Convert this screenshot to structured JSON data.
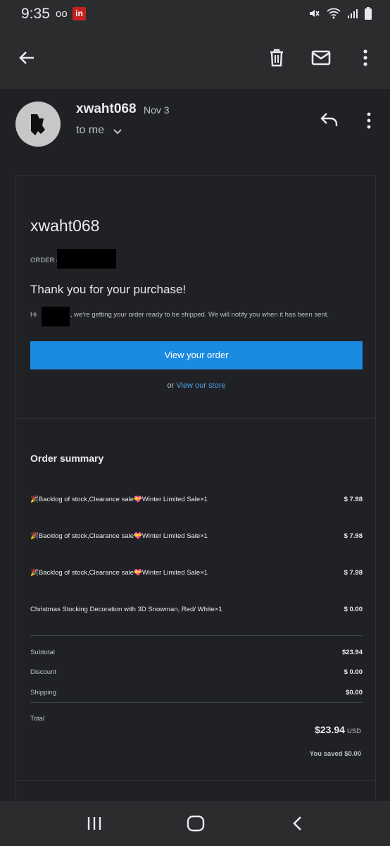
{
  "status": {
    "time": "9:35",
    "voicemail": "oo",
    "notif_badge": "in"
  },
  "appbar": {
    "back_icon": "arrow-left-icon",
    "delete_icon": "trash-icon",
    "mark_unread_icon": "envelope-icon",
    "more_icon": "more-vert-icon"
  },
  "email": {
    "sender": "xwaht068",
    "date": "Nov 3",
    "recipient": "to me",
    "reply_icon": "reply-icon"
  },
  "order": {
    "store_title": "xwaht068",
    "order_label": "ORDER #",
    "thanks": "Thank you for your purchase!",
    "hi_prefix": "Hi",
    "hi_message": "n, we're getting your order ready to be shipped. We will notify you when it has been sent.",
    "view_order": "View your order",
    "or_text": "or",
    "view_store": "View our store"
  },
  "summary": {
    "title": "Order summary",
    "items": [
      {
        "name": "🎉Backlog of stock,Clearance sale💝Winter Limited Sale×1",
        "price": "$ 7.98"
      },
      {
        "name": "🎉Backlog of stock,Clearance sale💝Winter Limited Sale×1",
        "price": "$ 7.98"
      },
      {
        "name": "🎉Backlog of stock,Clearance sale💝Winter Limited Sale×1",
        "price": "$ 7.98"
      },
      {
        "name": "Christmas Stocking Decoration with 3D Snowman, Red/ White×1",
        "price": "$ 0.00"
      }
    ],
    "subtotal_label": "Subtotal",
    "subtotal": "$23.94",
    "discount_label": "Discount",
    "discount": "$ 0.00",
    "shipping_label": "Shipping",
    "shipping": "$0.00",
    "total_label": "Total",
    "total": "$23.94",
    "currency": "USD",
    "saved": "You saved $0.00"
  },
  "colors": {
    "accent_button": "#1a8be0",
    "link": "#4aa3e8",
    "background": "#202124"
  }
}
